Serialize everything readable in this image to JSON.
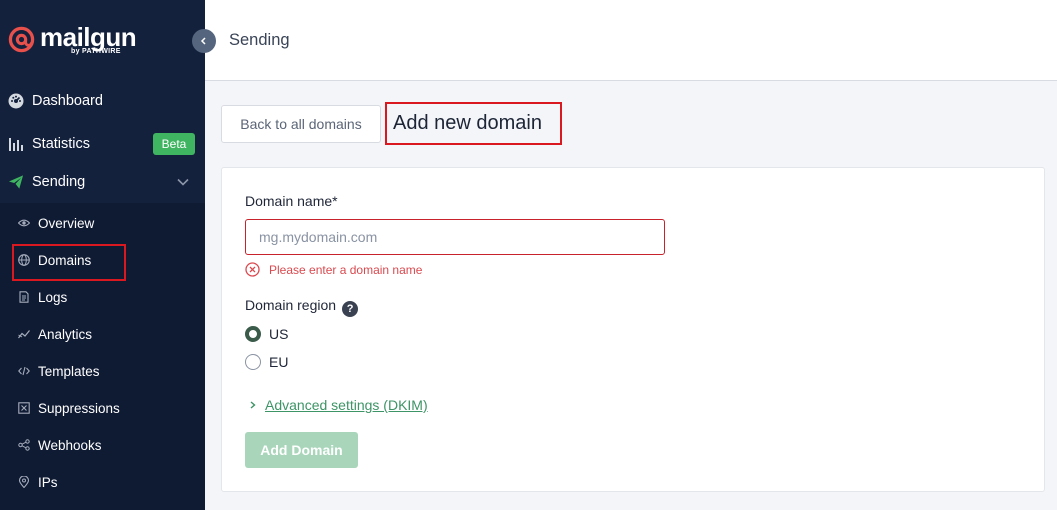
{
  "brand": {
    "name": "mailgun",
    "byline": "by PATHWIRE",
    "accent": "#e8504b"
  },
  "colors": {
    "sidebar": "#14213d",
    "submenu": "#0f1a33",
    "green": "#3fb461",
    "error": "#c8232c"
  },
  "header": {
    "title": "Sending"
  },
  "sidebar": {
    "main": [
      {
        "label": "Dashboard",
        "icon": "dashboard-icon"
      },
      {
        "label": "Statistics",
        "icon": "bar-chart-icon",
        "badge": "Beta"
      },
      {
        "label": "Sending",
        "icon": "paper-plane-icon"
      }
    ],
    "sub": [
      {
        "label": "Overview",
        "icon": "eye-icon"
      },
      {
        "label": "Domains",
        "icon": "globe-icon",
        "active": true
      },
      {
        "label": "Logs",
        "icon": "document-icon"
      },
      {
        "label": "Analytics",
        "icon": "trend-icon"
      },
      {
        "label": "Templates",
        "icon": "code-icon"
      },
      {
        "label": "Suppressions",
        "icon": "x-box-icon"
      },
      {
        "label": "Webhooks",
        "icon": "share-icon"
      },
      {
        "label": "IPs",
        "icon": "location-pin-icon"
      }
    ]
  },
  "main": {
    "back_label": "Back to all domains",
    "page_title": "Add new domain",
    "form": {
      "domain_label": "Domain name*",
      "domain_placeholder": "mg.mydomain.com",
      "domain_value": "",
      "error_text": "Please enter a domain name",
      "region_label": "Domain region",
      "regions": [
        {
          "label": "US",
          "selected": true
        },
        {
          "label": "EU",
          "selected": false
        }
      ],
      "advanced_label": "Advanced settings (DKIM)",
      "submit_label": "Add Domain"
    }
  }
}
